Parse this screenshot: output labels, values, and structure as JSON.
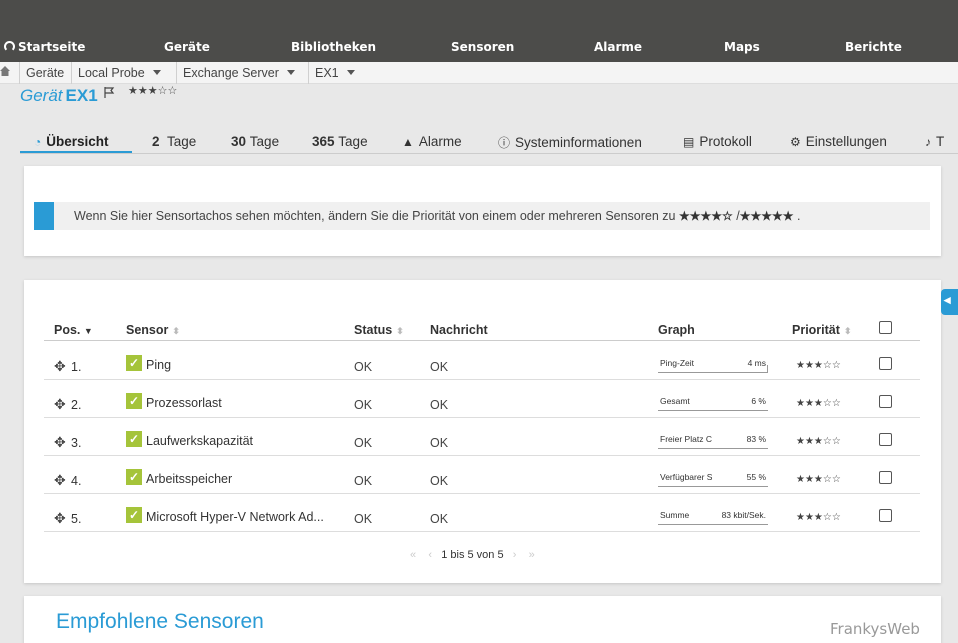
{
  "nav": {
    "home": "Startseite",
    "devices": "Geräte",
    "libraries": "Bibliotheken",
    "sensors": "Sensoren",
    "alarms": "Alarme",
    "maps": "Maps",
    "reports": "Berichte"
  },
  "breadcrumb": {
    "items": [
      "Geräte",
      "Local Probe",
      "Exchange Server",
      "EX1"
    ]
  },
  "device": {
    "label": "Gerät",
    "name": "EX1",
    "stars": "★★★☆☆"
  },
  "tabs": [
    {
      "num": "",
      "label": "Übersicht"
    },
    {
      "num": "2",
      "label": "Tage"
    },
    {
      "num": "30",
      "label": "Tage"
    },
    {
      "num": "365",
      "label": "Tage"
    },
    {
      "num": "",
      "label": "Alarme"
    },
    {
      "num": "",
      "label": "Systeminformationen"
    },
    {
      "num": "",
      "label": "Protokoll"
    },
    {
      "num": "",
      "label": "Einstellungen"
    },
    {
      "num": "",
      "label": "T"
    }
  ],
  "info": {
    "text": "Wenn Sie hier Sensortachos sehen möchten, ändern Sie die Priorität von einem oder mehreren Sensoren zu",
    "stars4": "★★★★☆",
    "sep": "/",
    "stars5": "★★★★★",
    "end": "."
  },
  "table": {
    "headers": {
      "pos": "Pos.",
      "sensor": "Sensor",
      "status": "Status",
      "message": "Nachricht",
      "graph": "Graph",
      "priority": "Priorität"
    },
    "rows": [
      {
        "pos": "1.",
        "sensor": "Ping",
        "status": "OK",
        "message": "OK",
        "graph_label": "Ping-Zeit",
        "graph_value": "4 ms",
        "priority": "★★★☆☆"
      },
      {
        "pos": "2.",
        "sensor": "Prozessorlast",
        "status": "OK",
        "message": "OK",
        "graph_label": "Gesamt",
        "graph_value": "6 %",
        "priority": "★★★☆☆"
      },
      {
        "pos": "3.",
        "sensor": "Laufwerkskapazität",
        "status": "OK",
        "message": "OK",
        "graph_label": "Freier Platz C",
        "graph_value": "83 %",
        "priority": "★★★☆☆"
      },
      {
        "pos": "4.",
        "sensor": "Arbeitsspeicher",
        "status": "OK",
        "message": "OK",
        "graph_label": "Verfügbarer S",
        "graph_value": "55 %",
        "priority": "★★★☆☆"
      },
      {
        "pos": "5.",
        "sensor": "Microsoft Hyper-V Network Ad...",
        "status": "OK",
        "message": "OK",
        "graph_label": "Summe",
        "graph_value": "83 kbit/Sek.",
        "priority": "★★★☆☆"
      }
    ]
  },
  "pager": {
    "first": "«",
    "prev": "‹",
    "text": "1 bis 5 von 5",
    "next": "›",
    "last": "»"
  },
  "recommended": {
    "title": "Empfohlene Sensoren"
  },
  "watermark": "FrankysWeb",
  "colors": {
    "accent": "#2a9bd5",
    "nav_bg": "#4c4c4a",
    "ok_green": "#a5c43a"
  }
}
